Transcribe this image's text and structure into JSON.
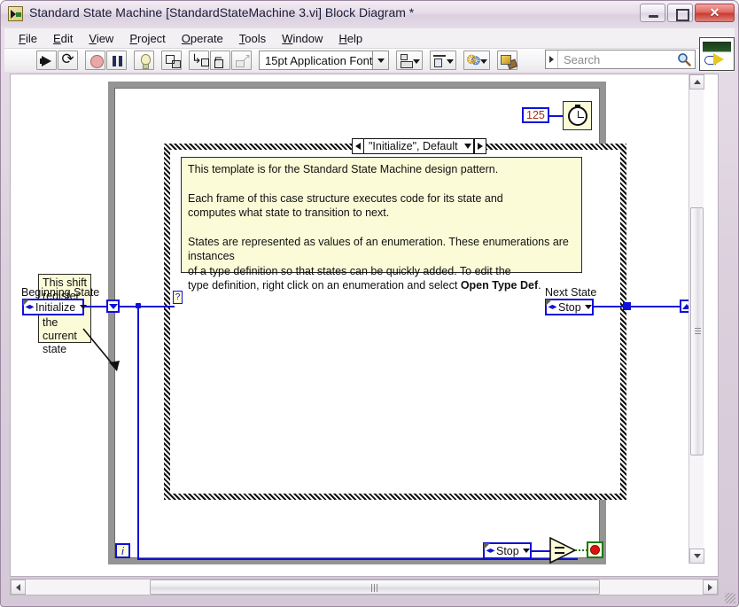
{
  "window": {
    "title": "Standard State Machine [StandardStateMachine 3.vi] Block Diagram *",
    "icon": "labview-vi-icon",
    "buttons": {
      "minimize": "minimize-icon",
      "maximize": "maximize-icon",
      "close": "close-icon"
    }
  },
  "menu": {
    "items": [
      {
        "label": "File",
        "mnemonic": "F"
      },
      {
        "label": "Edit",
        "mnemonic": "E"
      },
      {
        "label": "View",
        "mnemonic": "V"
      },
      {
        "label": "Project",
        "mnemonic": "P"
      },
      {
        "label": "Operate",
        "mnemonic": "O"
      },
      {
        "label": "Tools",
        "mnemonic": "T"
      },
      {
        "label": "Window",
        "mnemonic": "W"
      },
      {
        "label": "Help",
        "mnemonic": "H"
      }
    ]
  },
  "toolbar": {
    "run": "run-arrow-icon",
    "run_continuously": "run-continuously-icon",
    "abort": "abort-execution-icon",
    "pause": "pause-icon",
    "highlight_execution": "light-bulb-icon",
    "retain_wire_values": "probe-values-icon",
    "step_into": "step-into-icon",
    "step_over": "step-over-icon",
    "step_out": "step-out-icon",
    "font_label": "15pt Application Font",
    "align_objects": "align-objects-icon",
    "distribute_objects": "distribute-objects-icon",
    "reorder": "reorder-icon",
    "clean_up_diagram": "clean-up-diagram-icon",
    "help_button": "?"
  },
  "search": {
    "placeholder": "Search",
    "magnifier": "magnifier-icon"
  },
  "diagram": {
    "case_structure": {
      "selector_label": "\"Initialize\", Default",
      "selector_terminal": "?",
      "comment": {
        "paragraphs": [
          "This template is for the Standard State Machine design pattern.",
          "Each frame of this case structure executes code for its state and computes what state to transition to next.",
          "States are represented as values of an enumeration. These enumerations are instances of a type definition so that states can be quickly added. To edit the type definition, right click on an enumeration and select ",
          "Open Type Def."
        ],
        "line1": "This template is for the Standard State Machine design pattern.",
        "line2a": "Each frame of this case structure executes code for its state and",
        "line2b": "computes what state to transition to next.",
        "line3a": "States are represented as values of an enumeration. These enumerations are instances",
        "line3b": "of a type definition so that states can be quickly added. To edit the",
        "line3c_pre": "type definition, right click on an enumeration and select ",
        "line3c_bold": "Open Type Def",
        "line3c_post": "."
      }
    },
    "note": {
      "text": "This shift register stores the current state"
    },
    "beginning_state": {
      "label": "Beginning State",
      "value": "Initialize"
    },
    "next_state": {
      "label": "Next State",
      "value": "Stop"
    },
    "stop_constant": {
      "value": "Stop"
    },
    "wait_constant": {
      "value": "125"
    },
    "wait_vi": {
      "name": "wait-ms-timer-icon"
    },
    "iteration_terminal": {
      "label": "i"
    },
    "comparison": {
      "label": "=",
      "name": "equal-comparison-icon"
    },
    "stop_terminal": {
      "name": "stop-loop-terminal-icon"
    }
  },
  "colors": {
    "wire_blue": "#1010d8",
    "comment_yellow": "#fbfbd8",
    "loop_gray": "#949494",
    "stop_red": "#e01010",
    "stop_border_green": "#1a7a1a",
    "constant_red_text": "#a03010"
  },
  "scrollbars": {
    "vertical": "vertical-scrollbar",
    "horizontal": "horizontal-scrollbar"
  }
}
